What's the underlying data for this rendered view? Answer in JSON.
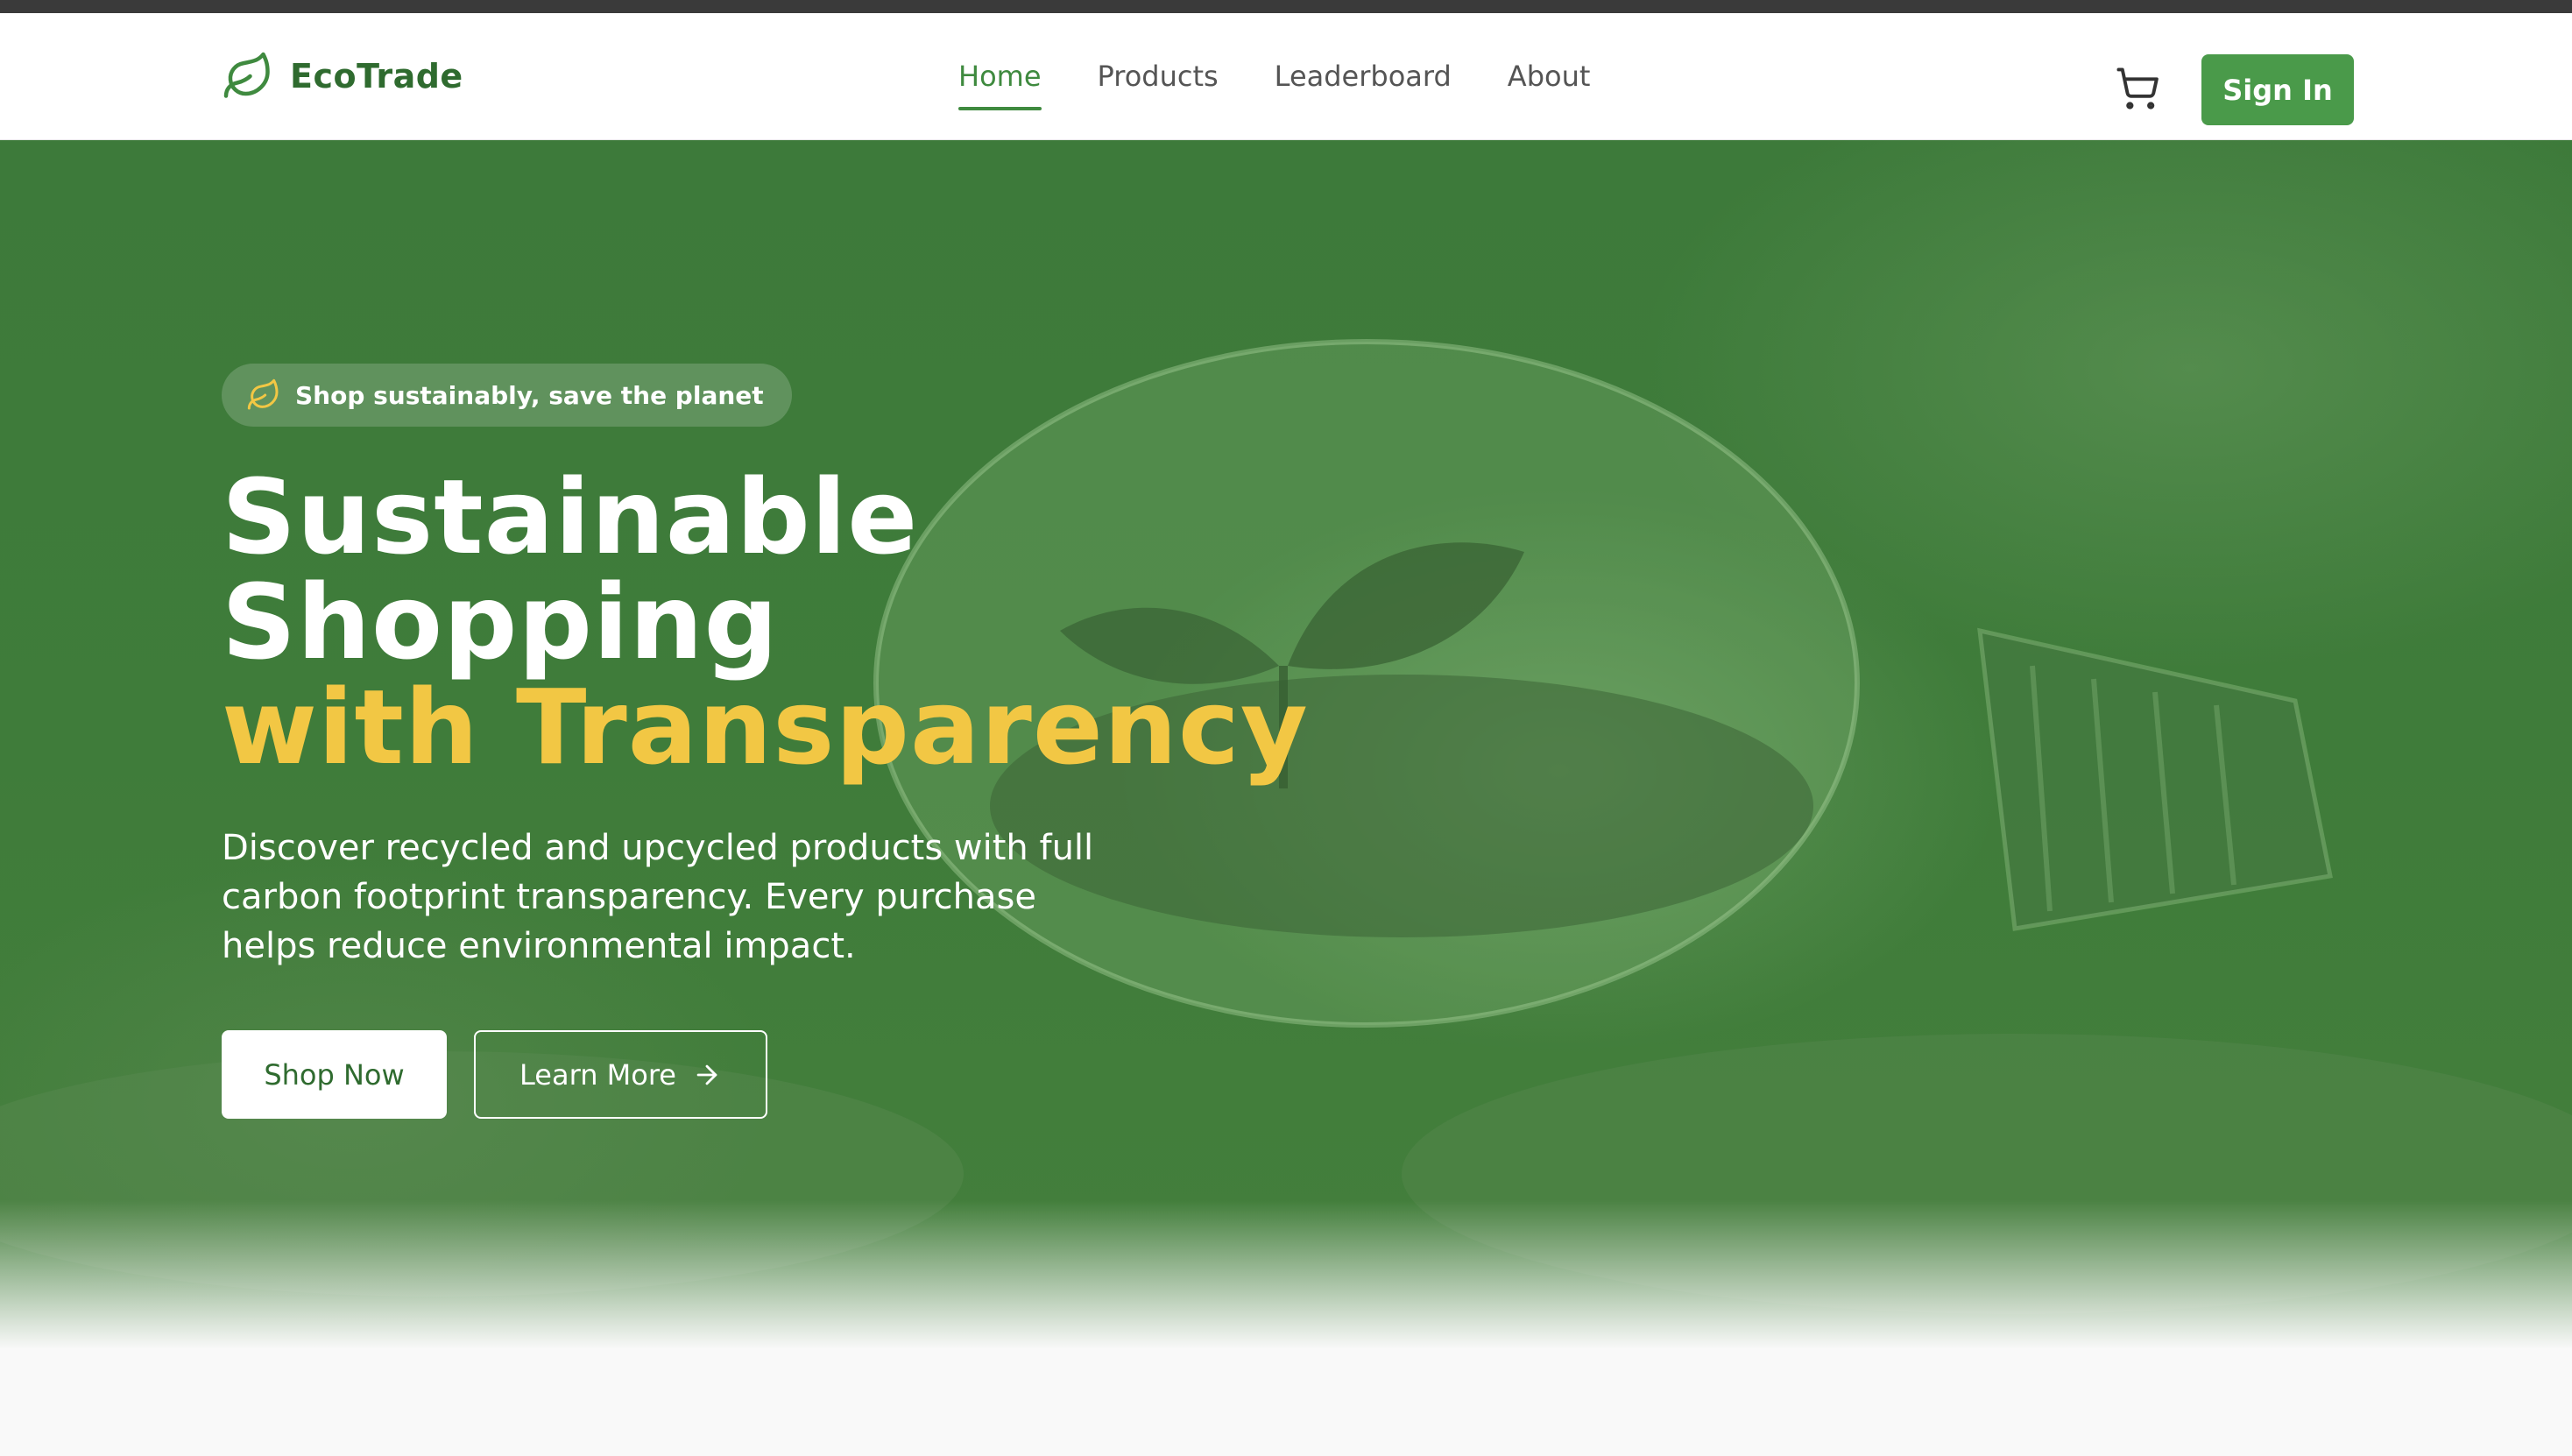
{
  "brand": {
    "name": "EcoTrade",
    "icon": "leaf-icon",
    "color": "#2f6b2f"
  },
  "nav": {
    "items": [
      {
        "label": "Home",
        "active": true
      },
      {
        "label": "Products",
        "active": false
      },
      {
        "label": "Leaderboard",
        "active": false
      },
      {
        "label": "About",
        "active": false
      }
    ],
    "cart_icon": "cart-icon",
    "signin_label": "Sign In"
  },
  "hero": {
    "badge": {
      "icon": "leaf-icon",
      "text": "Shop sustainably, save the planet"
    },
    "headline_line1": "Sustainable",
    "headline_line2": "Shopping",
    "headline_accent": "with Transparency",
    "description": "Discover recycled and upcycled products with full carbon footprint transparency. Every purchase helps reduce environmental impact.",
    "primary_button": "Shop Now",
    "secondary_button": "Learn More",
    "secondary_button_icon": "arrow-right-icon"
  },
  "colors": {
    "accent_green": "#4a9a4a",
    "active_nav": "#3f8a3f",
    "headline_accent": "#f2c744",
    "hero_overlay": "#3d7a3a"
  }
}
